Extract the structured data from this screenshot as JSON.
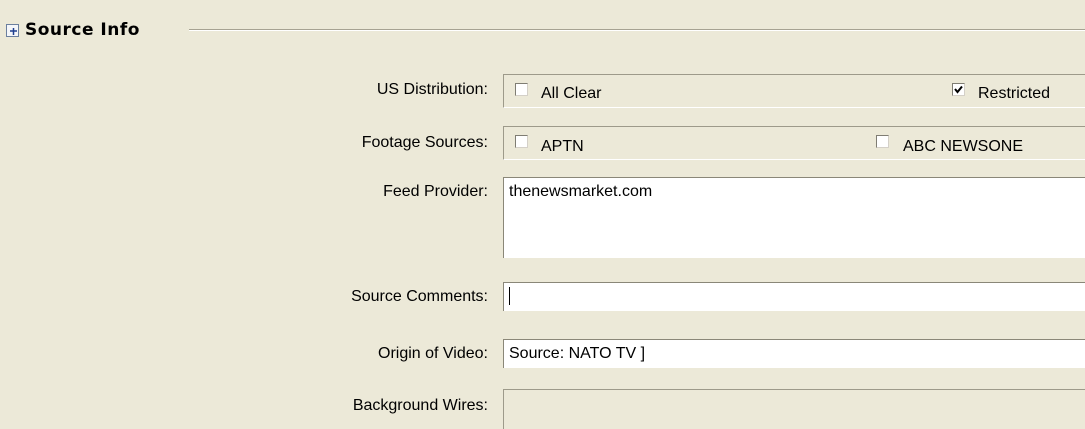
{
  "section": {
    "title": "Source Info",
    "toggle_icon": "collapse-toggle-icon"
  },
  "us_distribution": {
    "label": "US Distribution:",
    "options": [
      {
        "label": "All Clear",
        "checked": false
      },
      {
        "label": "Restricted",
        "checked": true
      }
    ]
  },
  "footage_sources": {
    "label": "Footage Sources:",
    "options": [
      {
        "label": "APTN",
        "checked": false
      },
      {
        "label": "ABC NEWSONE",
        "checked": false
      }
    ]
  },
  "feed_provider": {
    "label": "Feed Provider:",
    "value": "thenewsmarket.com"
  },
  "source_comments": {
    "label": "Source Comments:",
    "value": ""
  },
  "origin_of_video": {
    "label": "Origin of Video:",
    "value": "Source: NATO TV ]"
  },
  "background_wires": {
    "label": "Background Wires:",
    "value": ""
  },
  "colors": {
    "background": "#ECE9D8",
    "field_background": "#FFFFFF"
  }
}
